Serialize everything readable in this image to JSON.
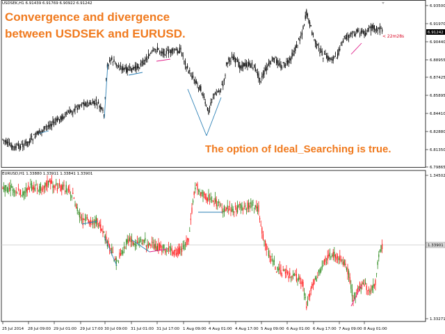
{
  "overlay": {
    "title_line1": "Convergence and divergence",
    "title_line2": "between USDSEK and EURUSD.",
    "note": "The option of Ideal_Searching is true."
  },
  "top_panel": {
    "header": "USDSEK,H1  6.91439 6.91769 6.90922 6.91242",
    "symbol": "USDSEK",
    "timeframe": "H1",
    "ohlc": [
      6.91439,
      6.91769,
      6.90922,
      6.91242
    ],
    "price_labels": [
      "6.93500",
      "6.91970",
      "6.90440",
      "6.88955",
      "6.87425",
      "6.85895",
      "6.84410",
      "6.82880",
      "6.81350",
      "6.79865"
    ],
    "current_price": "6.91242",
    "countdown": "< 22m28s",
    "ylim": [
      6.79865,
      6.935
    ]
  },
  "bottom_panel": {
    "header": "EURUSD,H1  1.33880 1.33911 1.33841 1.33901",
    "symbol": "EURUSD",
    "timeframe": "H1",
    "ohlc": [
      1.3388,
      1.33911,
      1.33841,
      1.33901
    ],
    "price_labels": [
      "1.34502",
      "1.33271"
    ],
    "current_price": "1.33901",
    "ylim": [
      1.33271,
      1.34502
    ]
  },
  "time_axis": [
    "25 Jul 2014",
    "28 Jul 09:00",
    "29 Jul 01:00",
    "29 Jul 17:00",
    "30 Jul 09:00",
    "31 Jul 01:00",
    "31 Jul 17:00",
    "1 Aug 09:00",
    "4 Aug 01:00",
    "4 Aug 17:00",
    "5 Aug 09:00",
    "6 Aug 01:00",
    "6 Aug 17:00",
    "7 Aug 09:00",
    "8 Aug 01:00"
  ],
  "colors": {
    "background": "#ffffff",
    "grid": "#c8c8c8",
    "bull_candle": "#2e8b1e",
    "bear_candle": "#ff1a1a",
    "usdsek_candle": "#000000",
    "divergence_line_magenta": "#e0208a",
    "divergence_line_blue": "#2a7fb5",
    "annotation_text": "#f07a1e",
    "countdown": "#d8001e"
  }
}
